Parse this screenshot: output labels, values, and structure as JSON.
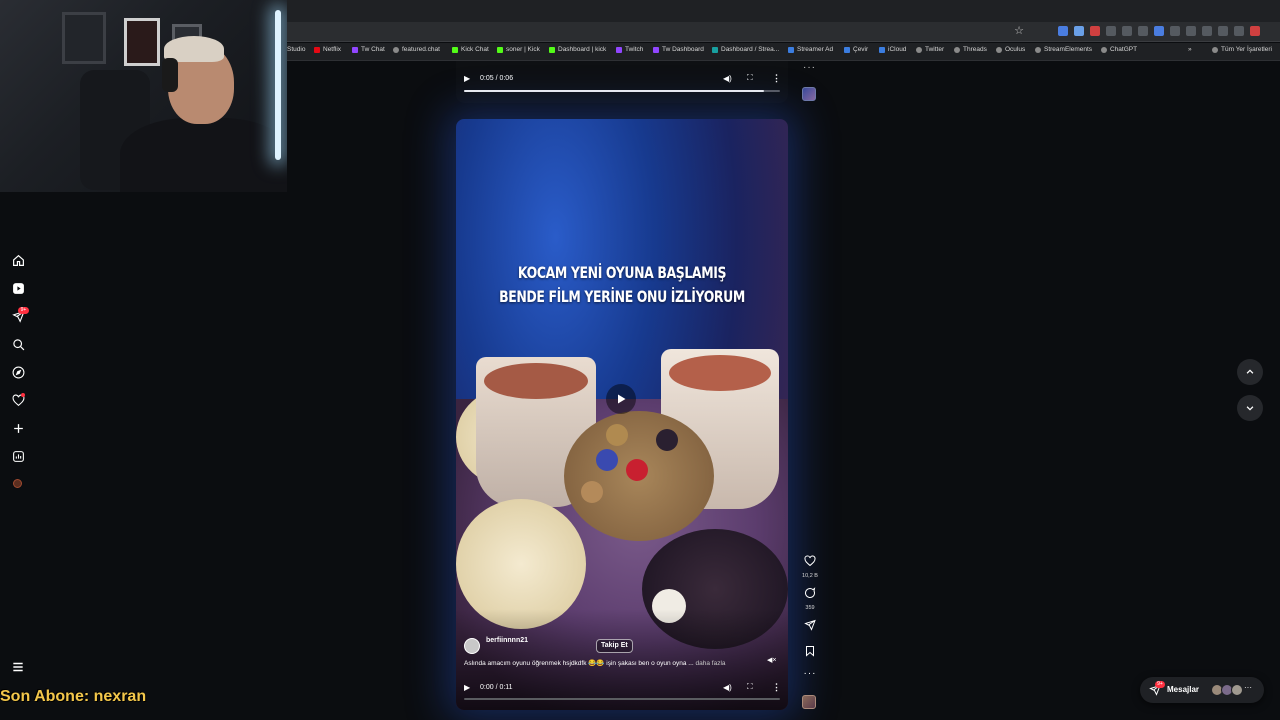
{
  "bookmarks": [
    "Studio",
    "Netflix",
    "Tw Chat",
    "featured.chat",
    "Kick Chat",
    "soner | Kick",
    "Dashboard | kick",
    "Twitch",
    "Tw Dashboard",
    "Dashboard / Strea...",
    "Streamer Ad",
    "Çevir",
    "iCloud",
    "Twitter",
    "Threads",
    "Oculus",
    "StreamElements",
    "ChatGPT"
  ],
  "bookmarks_overflow": "»",
  "all_bookmarks": "Tüm Yer İşaretleri",
  "nav": {
    "notification_badge": "9+"
  },
  "overlay": {
    "sub_text": "Son Abone: nexran"
  },
  "top_player": {
    "time": "0:05 / 0:06",
    "progress": 0.95,
    "more": "···"
  },
  "reel": {
    "caption_line1": "KOCAM YENİ OYUNA BAŞLAMIŞ",
    "caption_line2": "BENDE FİLM YERİNE ONU İZLİYORUM",
    "author": "berfiinnnn21",
    "follow_label": "Takip Et",
    "description": "Aslında amacım oyunu öğrenmek hsjdkdfk 😂😂 işin şakası ben o oyun oyna ...",
    "more_label": "daha fazla",
    "time": "0:00 / 0:11",
    "progress": 0.0,
    "likes": "10,2 B",
    "comments": "359",
    "more": "···"
  },
  "messages": {
    "label": "Mesajlar",
    "badge": "9+"
  },
  "colors": {
    "accent_blue": "#2a5cc9",
    "badge_red": "#ff3040",
    "sub_text": "#f3c74b"
  }
}
